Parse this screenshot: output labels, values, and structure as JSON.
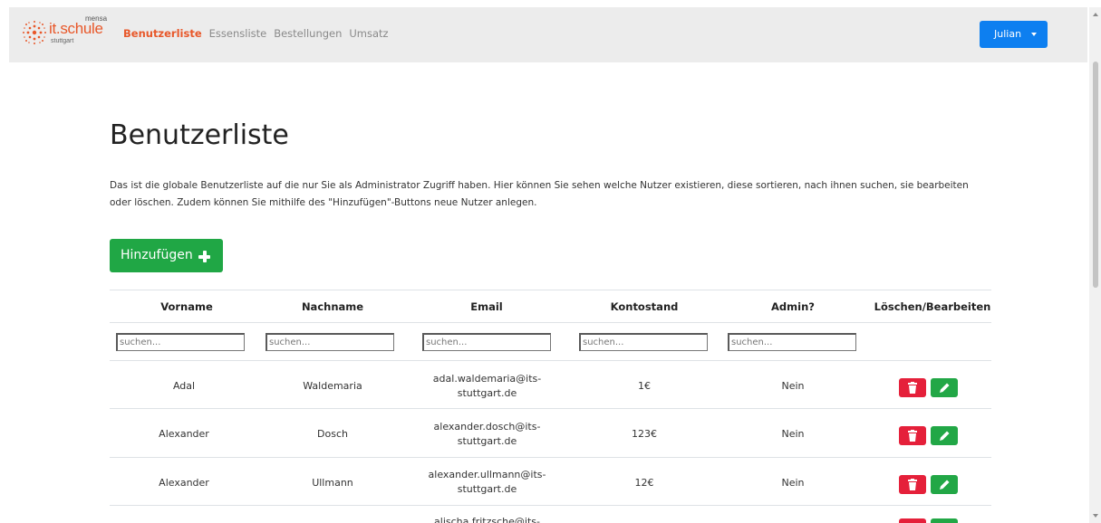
{
  "brand": {
    "tag": "mensa",
    "name": "it.schule",
    "city": "stuttgart"
  },
  "nav": {
    "items": [
      {
        "label": "Benutzerliste",
        "active": true
      },
      {
        "label": "Essensliste",
        "active": false
      },
      {
        "label": "Bestellungen",
        "active": false
      },
      {
        "label": "Umsatz",
        "active": false
      }
    ],
    "user_label": "Julian"
  },
  "page": {
    "title": "Benutzerliste",
    "intro": "Das ist die globale Benutzerliste auf die nur Sie als Administrator Zugriff haben. Hier können Sie sehen welche Nutzer existieren, diese sortieren, nach ihnen suchen, sie bearbeiten oder löschen. Zudem können Sie mithilfe des \"Hinzufügen\"-Buttons neue Nutzer anlegen.",
    "add_label": "Hinzufügen"
  },
  "table": {
    "headers": [
      "Vorname",
      "Nachname",
      "Email",
      "Kontostand",
      "Admin?",
      "Löschen/Bearbeiten"
    ],
    "search_placeholder": "suchen...",
    "rows": [
      {
        "vorname": "Adal",
        "nachname": "Waldemaria",
        "email_1": "adal.waldemaria@its-",
        "email_2": "stuttgart.de",
        "kontostand": "1€",
        "admin": "Nein"
      },
      {
        "vorname": "Alexander",
        "nachname": "Dosch",
        "email_1": "alexander.dosch@its-",
        "email_2": "stuttgart.de",
        "kontostand": "123€",
        "admin": "Nein"
      },
      {
        "vorname": "Alexander",
        "nachname": "Ullmann",
        "email_1": "alexander.ullmann@its-",
        "email_2": "stuttgart.de",
        "kontostand": "12€",
        "admin": "Nein"
      },
      {
        "vorname": "",
        "nachname": "",
        "email_1": "alischa.fritzsche@its-",
        "email_2": "",
        "kontostand": "",
        "admin": ""
      }
    ]
  },
  "colors": {
    "brand_orange": "#e8582a",
    "primary_blue": "#0d7ff0",
    "success_green": "#20a745",
    "danger_red": "#e5203a",
    "navbar_bg": "#ececec"
  },
  "icons": {
    "delete": "trash-icon",
    "edit": "pencil-icon",
    "add": "plus-icon",
    "user_menu": "caret-down-icon",
    "logo": "sunburst-logo-icon"
  }
}
